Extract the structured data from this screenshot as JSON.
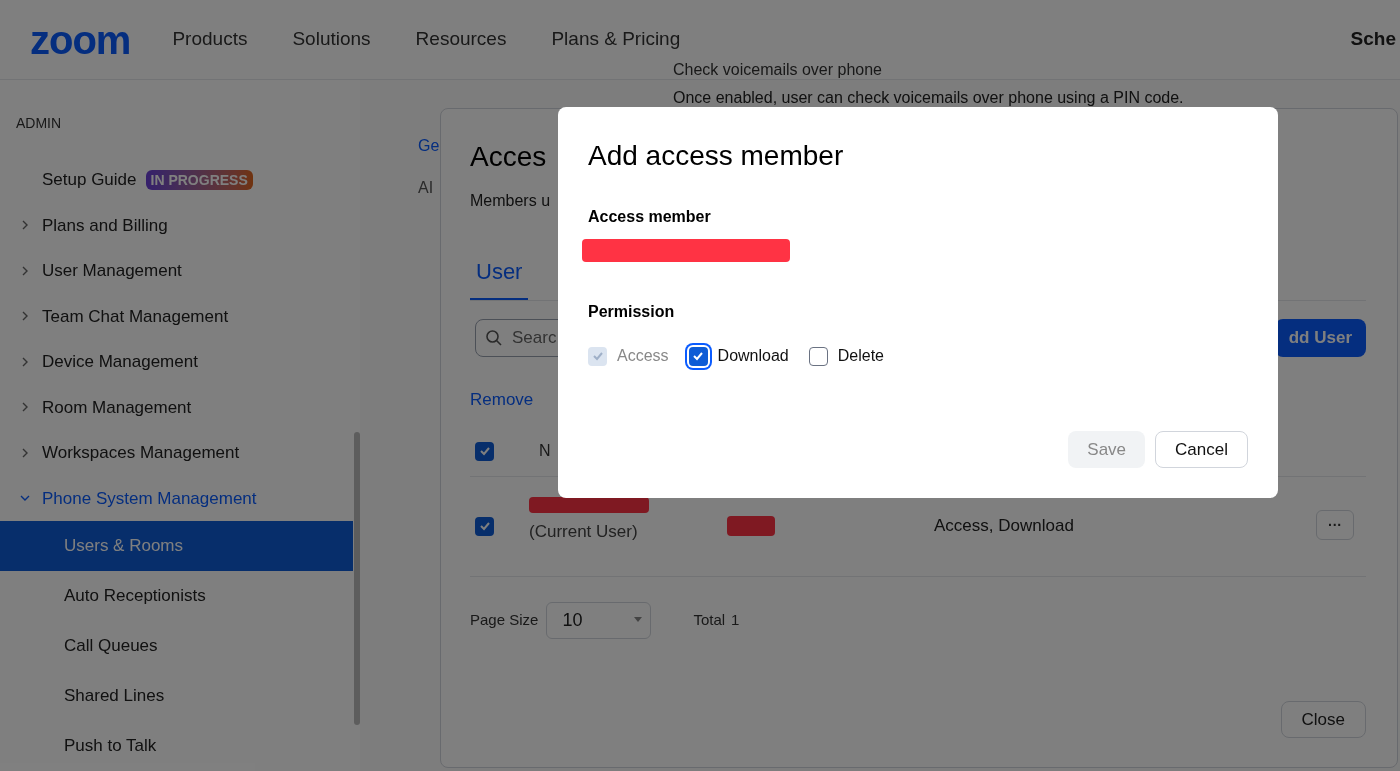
{
  "header": {
    "logo": "zoom",
    "nav": [
      "Products",
      "Solutions",
      "Resources",
      "Plans & Pricing"
    ],
    "right_text": "Sche"
  },
  "background_text": [
    "Check voicemails over phone",
    "Once enabled, user can check voicemails over phone using a PIN code."
  ],
  "sidebar": {
    "section": "ADMIN",
    "items": [
      {
        "label": "Setup Guide",
        "badge": "IN PROGRESS"
      },
      {
        "label": "Plans and Billing",
        "expanded": false
      },
      {
        "label": "User Management",
        "expanded": false
      },
      {
        "label": "Team Chat Management",
        "expanded": false
      },
      {
        "label": "Device Management",
        "expanded": false
      },
      {
        "label": "Room Management",
        "expanded": false
      },
      {
        "label": "Workspaces Management",
        "expanded": false
      },
      {
        "label": "Phone System Management",
        "expanded": true,
        "children": [
          {
            "label": "Users & Rooms",
            "selected": true
          },
          {
            "label": "Auto Receptionists",
            "selected": false
          },
          {
            "label": "Call Queues",
            "selected": false
          },
          {
            "label": "Shared Lines",
            "selected": false
          },
          {
            "label": "Push to Talk",
            "selected": false
          }
        ]
      }
    ]
  },
  "settings_nav": [
    {
      "label": "Ge",
      "selected": true
    },
    {
      "label": "AI",
      "selected": false
    }
  ],
  "panel": {
    "title": "Acces",
    "description": "Members u",
    "tabs": [
      {
        "label": "User",
        "selected": true
      }
    ],
    "search": {
      "placeholder": "Searc"
    },
    "add_button": "dd User",
    "remove_link": "Remove",
    "header_checkbox": {
      "checked": true
    },
    "column_1": "N",
    "rows": [
      {
        "checked": true,
        "note": "(Current User)",
        "permissions": "Access, Download",
        "menu": "···"
      }
    ],
    "page_size_label": "Page Size",
    "page_size": "10",
    "total_label": "Total",
    "total": "1",
    "close_button": "Close"
  },
  "modal": {
    "title": "Add access member",
    "member_label": "Access member",
    "permission_label": "Permission",
    "permissions": [
      {
        "label": "Access",
        "checked": true,
        "disabled": true
      },
      {
        "label": "Download",
        "checked": true,
        "disabled": false
      },
      {
        "label": "Delete",
        "checked": false,
        "disabled": false
      }
    ],
    "save_button": {
      "label": "Save",
      "disabled": true
    },
    "cancel_button": "Cancel"
  }
}
